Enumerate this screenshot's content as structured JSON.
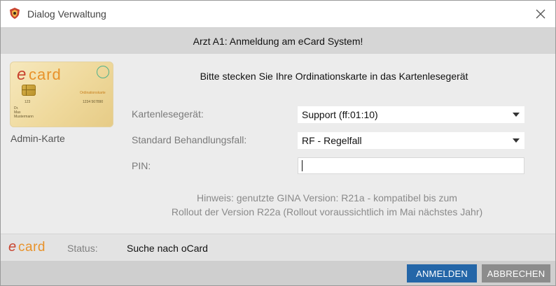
{
  "window": {
    "title": "Dialog Verwaltung",
    "icon": "app-shield-icon",
    "close_icon": "close-icon"
  },
  "header": {
    "text": "Arzt A1: Anmeldung am eCard System!"
  },
  "card": {
    "label": "Admin-Karte",
    "logo_text": "ecard",
    "number_left": "123",
    "number_right": "1234 567890",
    "issuer": "Ordinationskarte",
    "holder_line1": "Dr.",
    "holder_line2": "Max",
    "holder_line3": "Mustermann"
  },
  "instruction": "Bitte stecken Sie Ihre Ordinationskarte in das Kartenlesegerät",
  "form": {
    "reader_label": "Kartenlesegerät:",
    "reader_value": "Support (ff:01:10)",
    "case_label": "Standard Behandlungsfall:",
    "case_value": "RF - Regelfall",
    "pin_label": "PIN:",
    "pin_value": ""
  },
  "hint": {
    "line1": "Hinweis: genutzte GINA Version: R21a - kompatibel bis zum",
    "line2": "Rollout der Version R22a (Rollout voraussichtlich im Mai nächstes Jahr)"
  },
  "status": {
    "logo_text": "ecard",
    "label": "Status:",
    "value": "Suche nach oCard"
  },
  "buttons": {
    "login": "ANMELDEN",
    "cancel": "ABBRECHEN"
  },
  "colors": {
    "primary_button": "#2466a8",
    "secondary_button": "#8c8c8c",
    "ecard_red": "#c8432f",
    "ecard_orange": "#e8922a"
  }
}
